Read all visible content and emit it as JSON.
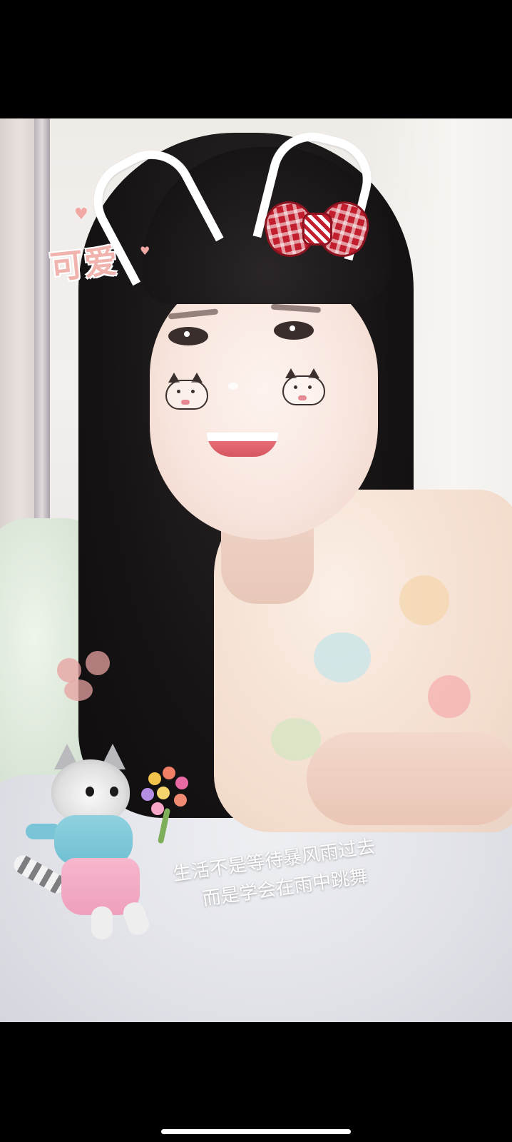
{
  "stickers": {
    "cute_label": "可爱",
    "heart_glyph": "♥",
    "caption_line1": "生活不是等待暴风雨过去",
    "caption_line2": "而是学会在雨中跳舞"
  },
  "colors": {
    "frame_background": "#000000",
    "bow_red": "#c21e2d",
    "sticker_pink": "#f0b3ad",
    "caption_white": "#ffffff"
  },
  "icons": {
    "headband": "cat-ear-headband-icon",
    "bow": "gingham-bow-icon",
    "cheek": "cat-face-cheek-icon",
    "paws": "paw-print-icon",
    "mascot": "cat-with-flowers-icon"
  }
}
